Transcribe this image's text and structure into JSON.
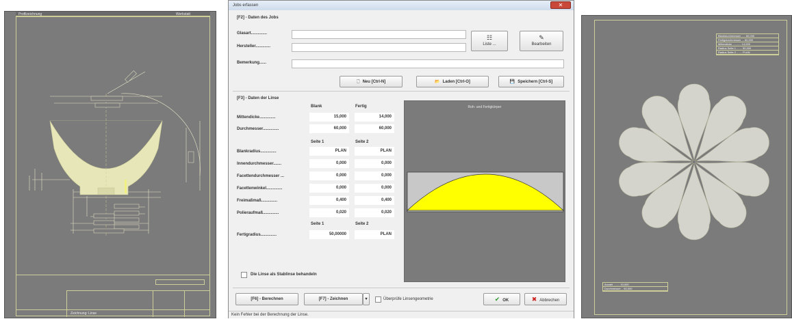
{
  "left_panel": {
    "header_left": "Profilzeichnung",
    "header_mid": "",
    "header_right": "Werkstatt",
    "footer_label": "Zeichnung: Linse"
  },
  "dialog": {
    "title": "Jobs erfassen",
    "close_glyph": "✕",
    "section_job": "[F2] - Daten des Jobs",
    "glasart_label": "Glasart..............",
    "hersteller_label": "Hersteller.............",
    "bemerkung_label": "Bemerkung......",
    "glasart_value": "",
    "hersteller_value": "",
    "bemerkung_value": "",
    "liste_button": "Liste ...",
    "bearbeiten_button": "Bearbeiten",
    "neu_button": "Neu [Ctrl-N]",
    "laden_button": "Laden [Ctrl-O]",
    "speichern_button": "Speichern [Ctrl-S]",
    "section_lens": "[F3] - Daten der Linse",
    "col_blank": "Blank",
    "col_fertig": "Fertig",
    "col_seite1": "Seite 1",
    "col_seite2": "Seite 2",
    "rows_top": [
      {
        "label": "Mittendicke..............",
        "v1": "15,000",
        "v2": "14,000"
      },
      {
        "label": "Durchmesser..............",
        "v1": "60,000",
        "v2": "60,000"
      }
    ],
    "rows_mid": [
      {
        "label": "Blankradius..............",
        "v1": "PLAN",
        "v2": "PLAN"
      },
      {
        "label": "Innendurchmesser.......",
        "v1": "0,000",
        "v2": "0,000"
      },
      {
        "label": "Facettendurchmesser ...",
        "v1": "0,000",
        "v2": "0,000"
      },
      {
        "label": "Facettenwinkel..............",
        "v1": "0,000",
        "v2": "0,000"
      },
      {
        "label": "Freimaßmaß..............",
        "v1": "0,400",
        "v2": "0,400"
      },
      {
        "label": "Polieraufmaß..............",
        "v1": "0,020",
        "v2": "0,020"
      }
    ],
    "fertigradius": {
      "label": "Fertigradius..............",
      "v1": "50,00000",
      "v2": "PLAN"
    },
    "preview_title": "Roh- und Fertigkörper",
    "stablinse_label": "Die Linse als Stablinse behandeln",
    "berechnen_button": "[F6] - Berechnen",
    "zeichnen_button": "[F7] - Zeichnen",
    "zeichnen_dropdown": "▾",
    "ueberpruefe_label": "Überprüfe Linsengeometrie",
    "ok_button": "OK",
    "abbrechen_button": "Abbrechen",
    "status": "Kein Fehler bei der Berechnung der Linse.",
    "icons": {
      "liste": "☷",
      "bearbeiten": "✎",
      "neu": "🗋",
      "laden": "📂",
      "speichern": "💾",
      "ok": "✔",
      "abbrechen": "✖"
    }
  },
  "right_panel": {
    "infobox_top": [
      "Blankdurchmesser ..... 60,000",
      "Fertigdurchmesser ... 60,000",
      "Mittendicke ........... 14,000",
      "Radius Seite 1 ....... 50,000",
      "Radius Seite 2 ....... PLAN"
    ],
    "infobox_bottom": [
      "Anzahl ........ 10,000",
      "Durchmesser .. 60,000"
    ]
  },
  "colors": {
    "cad_bg": "#7b7b7b",
    "cad_line": "#cfcf9a",
    "lens_fill": "#ffff00",
    "petal_fill": "#d4d4cc"
  }
}
